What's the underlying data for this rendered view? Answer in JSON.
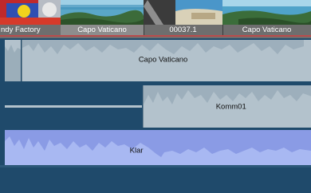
{
  "video_track": {
    "clips": [
      {
        "label": "ndy Factory",
        "selected": false
      },
      {
        "label": "Capo Vaticano",
        "selected": true
      },
      {
        "label": "00037.1",
        "selected": false
      },
      {
        "label": "Capo Vaticano",
        "selected": false
      }
    ]
  },
  "audio_tracks": {
    "track1": {
      "clip_label": "Capo Vaticano"
    },
    "track2": {
      "clip_label": "Komm01"
    },
    "track3": {
      "clip_label": "Klar"
    }
  },
  "colors": {
    "track_background": "#1f4a6b",
    "audio_clip": "#b3c2cc",
    "audio_clip_selected": "#a8b8f2",
    "waveform": "#8aa0ae",
    "waveform_selected": "#7d8fe0",
    "timeline_marker": "#cc4444"
  }
}
